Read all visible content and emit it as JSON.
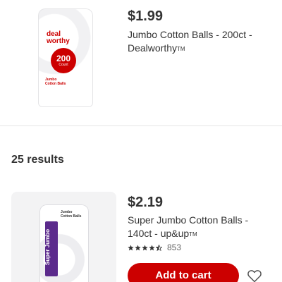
{
  "products": [
    {
      "price": "$1.99",
      "title": "Jumbo Cotton Balls - 200ct - Dealworthy",
      "trademark": "TM",
      "package": {
        "brand_line1": "deal",
        "brand_line2": "worthy",
        "count_number": "200",
        "count_label": "Count",
        "sub_line1": "Jumbo",
        "sub_line2": "Cotton Balls"
      }
    },
    {
      "price": "$2.19",
      "title": "Super Jumbo Cotton Balls - 140ct - up&up",
      "trademark": "TM",
      "rating": 4.5,
      "review_count": "853",
      "add_to_cart_label": "Add to cart",
      "package": {
        "band_text": "Super Jumbo",
        "label_line1": "Jumbo",
        "label_line2": "Cotton Balls"
      }
    }
  ],
  "results_label": "25 results",
  "icons": {
    "favorite": "heart-outline-icon",
    "star": "star-icon"
  },
  "colors": {
    "accent": "#cc0000",
    "text": "#333333",
    "star": "#333333"
  }
}
